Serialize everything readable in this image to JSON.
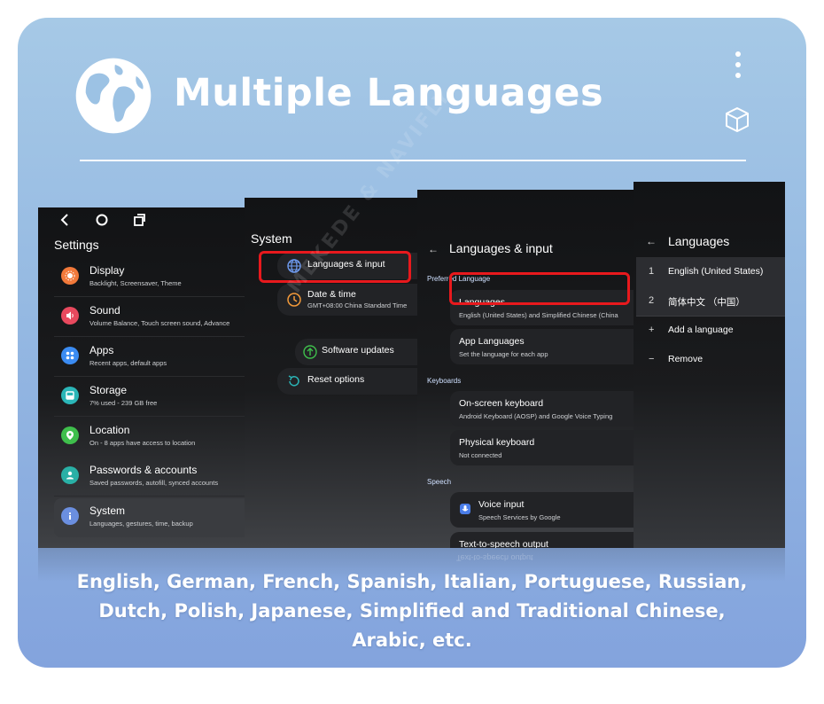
{
  "header": {
    "title": "Multiple Languages"
  },
  "settings_screen": {
    "title": "Settings",
    "items": [
      {
        "label": "Display",
        "sub": "Backlight, Screensaver, Theme",
        "icon": "display-icon",
        "color": "#f2793a"
      },
      {
        "label": "Sound",
        "sub": "Volume Balance, Touch screen sound, Advance",
        "icon": "sound-icon",
        "color": "#e8495e"
      },
      {
        "label": "Apps",
        "sub": "Recent apps, default apps",
        "icon": "apps-icon",
        "color": "#3b8cf3"
      },
      {
        "label": "Storage",
        "sub": "7% used - 239 GB free",
        "icon": "storage-icon",
        "color": "#2bb6b8"
      },
      {
        "label": "Location",
        "sub": "On - 8 apps have access to location",
        "icon": "location-icon",
        "color": "#3fbf4c"
      },
      {
        "label": "Passwords & accounts",
        "sub": "Saved passwords, autofill, synced accounts",
        "icon": "account-icon",
        "color": "#29b0a6"
      },
      {
        "label": "System",
        "sub": "Languages, gestures, time, backup",
        "icon": "info-icon",
        "color": "#6b8fe0"
      }
    ]
  },
  "system_screen": {
    "title": "System",
    "items": [
      {
        "label": "Languages & input",
        "sub": "",
        "icon": "globe-icon"
      },
      {
        "label": "Date & time",
        "sub": "GMT+08:00 China Standard Time",
        "icon": "clock-icon"
      },
      {
        "label": "Software updates",
        "sub": "",
        "icon": "update-icon"
      },
      {
        "label": "Reset options",
        "sub": "",
        "icon": "reset-icon"
      }
    ]
  },
  "lang_input_screen": {
    "title": "Languages & input",
    "sections": {
      "preferred": "Preferred Language",
      "keyboards": "Keyboards",
      "speech": "Speech"
    },
    "items": [
      {
        "label": "Languages",
        "sub": "English (United States) and Simplified Chinese (China"
      },
      {
        "label": "App Languages",
        "sub": "Set the language for each app"
      },
      {
        "label": "On-screen keyboard",
        "sub": "Android Keyboard (AOSP) and Google Voice Typing"
      },
      {
        "label": "Physical keyboard",
        "sub": "Not connected"
      },
      {
        "label": "Voice input",
        "sub": "Speech Services by Google"
      },
      {
        "label": "Text-to-speech output",
        "sub": ""
      }
    ]
  },
  "languages_screen": {
    "title": "Languages",
    "list": [
      {
        "num": "1",
        "label": "English (United States)"
      },
      {
        "num": "2",
        "label": "简体中文 （中国）"
      }
    ],
    "actions": [
      {
        "symbol": "+",
        "label": "Add a language"
      },
      {
        "symbol": "−",
        "label": "Remove"
      }
    ]
  },
  "reflection": {
    "text": "Text-to-speech output"
  },
  "caption": {
    "line1": "English, German, French, Spanish, Italian, Portuguese, Russian,",
    "line2": "Dutch, Polish, Japanese, Simplified and Traditional Chinese,",
    "line3": "Arabic, etc."
  },
  "colors": {
    "highlight": "#e8191d",
    "card_top": "#a6c9e6",
    "card_bottom": "#83a3dd"
  }
}
